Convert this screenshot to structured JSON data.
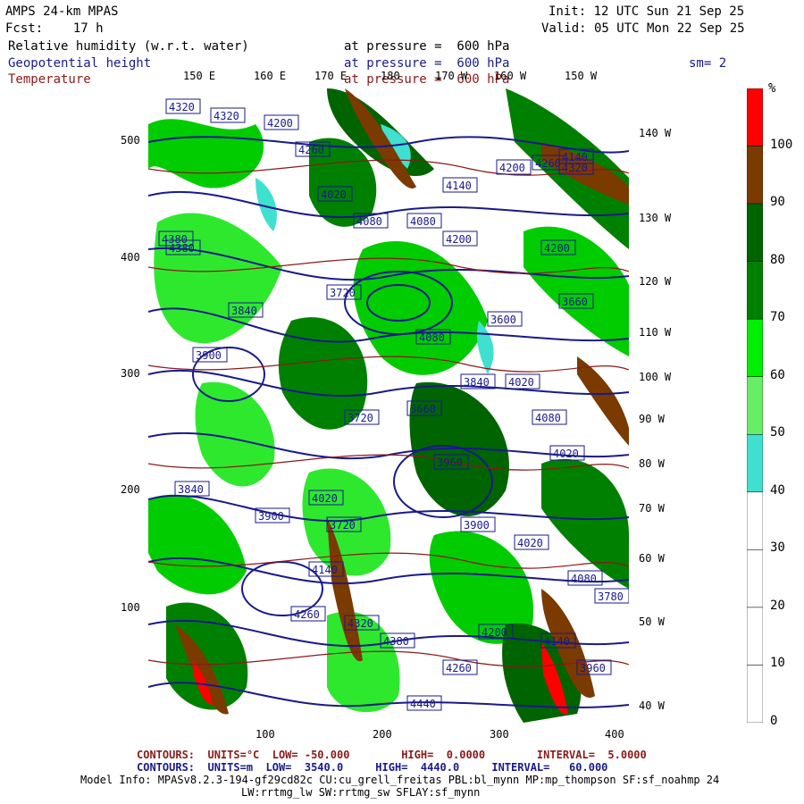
{
  "header": {
    "model": "AMPS 24-km MPAS",
    "fcst": "Fcst:    17 h",
    "init": "Init: 12 UTC Sun 21 Sep 25",
    "valid": "Valid: 05 UTC Mon 22 Sep 25",
    "smooth": "sm= 2"
  },
  "fields": [
    {
      "name": "Relative humidity (w.r.t. water)",
      "level": "at pressure =  600 hPa",
      "color": "#000000"
    },
    {
      "name": "Geopotential height",
      "level": "at pressure =  600 hPa",
      "color": "#1a1a8a"
    },
    {
      "name": "Temperature",
      "level": "at pressure =  600 hPa",
      "color": "#8a1a1a"
    }
  ],
  "map": {
    "top_lon_labels": [
      "150 E",
      "160 E",
      "170 E",
      "180",
      "170 W",
      "160 W",
      "150 W"
    ],
    "right_lon_labels": [
      "140 W",
      "130 W",
      "120 W",
      "110 W",
      "100 W",
      "90 W",
      "80 W",
      "70 W",
      "60 W",
      "50 W",
      "40 W"
    ],
    "y_ticks": [
      "500",
      "400",
      "300",
      "200",
      "100"
    ],
    "x_ticks": [
      "100",
      "200",
      "300",
      "400"
    ],
    "height_labels": [
      "4320",
      "4320",
      "4200",
      "4260",
      "4380",
      "4020",
      "4080",
      "4080",
      "4140",
      "4200",
      "4260",
      "4140",
      "3720",
      "3840",
      "4200",
      "3900",
      "3720",
      "3660",
      "4080",
      "4020",
      "3600",
      "3660",
      "3900",
      "4020",
      "3840",
      "3720",
      "3960",
      "3900",
      "4020",
      "4080",
      "4140",
      "4260",
      "4320",
      "4380",
      "4440",
      "4260",
      "4200",
      "4140",
      "3960",
      "3780",
      "4020",
      "3840",
      "4080",
      "4200",
      "4320",
      "4380"
    ]
  },
  "colorbar": {
    "unit": "%",
    "labels": [
      "100",
      "90",
      "80",
      "70",
      "60",
      "50",
      "40",
      "30",
      "20",
      "10",
      "0"
    ],
    "colors": [
      "#ff0000",
      "#7a3a00",
      "#006400",
      "#008000",
      "#00ee00",
      "#66ee66",
      "#40e0d0",
      "#ffffff",
      "#ffffff",
      "#ffffff",
      "#ffffff"
    ]
  },
  "footer": {
    "line1_red": "CONTOURS:  UNITS=°C  LOW= -50.000        HIGH=  0.0000        INTERVAL=  5.0000",
    "line2_blue": "CONTOURS:  UNITS=m  LOW=  3540.0     HIGH=  4440.0     INTERVAL=   60.000",
    "line3": "Model Info: MPASv8.2.3-194-gf29cd82c CU:cu_grell_freitas PBL:bl_mynn MP:mp_thompson SF:sf_noahmp 24",
    "line4": "LW:rrtmg_lw SW:rrtmg_sw SFLAY:sf_mynn"
  }
}
